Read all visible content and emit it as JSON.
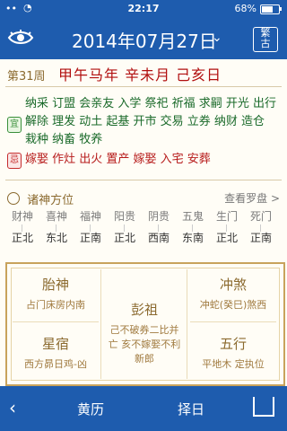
{
  "status": {
    "carrier": "••",
    "time": "22:17",
    "battery": "68%"
  },
  "header": {
    "date": "2014年07月27日",
    "trad_simp": "繁\n古"
  },
  "dayinfo": {
    "week": "第31周",
    "ganzhi": "甲午马年 辛未月 己亥日"
  },
  "yi": {
    "label": "宜",
    "text": "纳采 订盟 会亲友 入学 祭祀 祈福 求嗣 开光 出行 解除 理发 动土 起基 开市 交易 立券 纳财 造仓 栽种 纳畜 牧养"
  },
  "ji": {
    "label": "忌",
    "text": "嫁娶 作灶 出火 置产 嫁娶 入宅 安葬"
  },
  "directions": {
    "title": "诸神方位",
    "link": "查看罗盘 >",
    "items": [
      {
        "name": "财神",
        "value": "正北"
      },
      {
        "name": "喜神",
        "value": "东北"
      },
      {
        "name": "福神",
        "value": "正南"
      },
      {
        "name": "阳贵",
        "value": "正北"
      },
      {
        "name": "阴贵",
        "value": "西南"
      },
      {
        "name": "五鬼",
        "value": "东南"
      },
      {
        "name": "生门",
        "value": "正北"
      },
      {
        "name": "死门",
        "value": "正南"
      }
    ]
  },
  "panels": {
    "taishen": {
      "title": "胎神",
      "text": "占门床房内南"
    },
    "pengzu": {
      "title": "彭祖",
      "text": "己不破券二比并亡 亥不嫁娶不利新郎"
    },
    "chongsha": {
      "title": "冲煞",
      "text": "冲蛇(癸巳)煞西"
    },
    "xingxiu": {
      "title": "星宿",
      "text": "西方昴日鸡-凶"
    },
    "wuxing": {
      "title": "五行",
      "text": "平地木 定执位"
    }
  },
  "tabs": {
    "tab1": "黄历",
    "tab2": "择日"
  }
}
